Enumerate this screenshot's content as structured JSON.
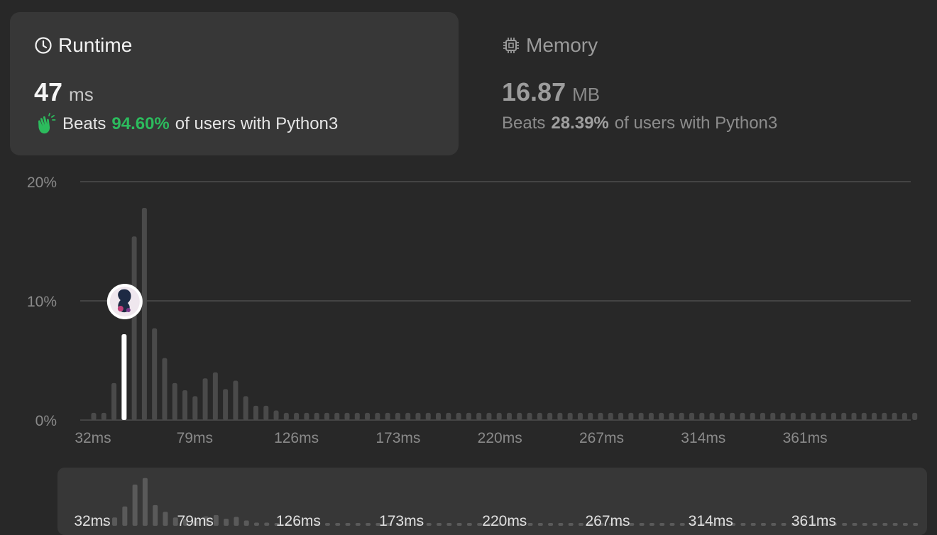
{
  "runtime": {
    "title": "Runtime",
    "value": "47",
    "unit": "ms",
    "beats_label": "Beats",
    "beats_pct": "94.60%",
    "beats_suffix": "of users with Python3",
    "icon": "clock-icon",
    "badge_icon": "clapping-hand-icon"
  },
  "memory": {
    "title": "Memory",
    "value": "16.87",
    "unit": "MB",
    "beats_label": "Beats",
    "beats_pct": "28.39%",
    "beats_suffix": "of users with Python3",
    "icon": "chip-icon"
  },
  "colors": {
    "background": "#282828",
    "card": "#373737",
    "bar": "#4a4a4a",
    "highlight_bar": "#ffffff",
    "accent_green": "#2cbb5d"
  },
  "chart_data": {
    "type": "bar",
    "xlabel": "",
    "ylabel": "",
    "ylim": [
      0,
      20
    ],
    "y_ticks": [
      "20%",
      "10%",
      "0%"
    ],
    "x_ticks": [
      "32ms",
      "79ms",
      "126ms",
      "173ms",
      "220ms",
      "267ms",
      "314ms",
      "361ms"
    ],
    "x_start_ms": 32,
    "x_step_ms": 4.7,
    "highlight_index": 3,
    "values": [
      0.6,
      0.6,
      3.1,
      7.2,
      15.4,
      17.8,
      7.7,
      5.2,
      3.1,
      2.5,
      2.0,
      3.5,
      4.0,
      2.6,
      3.3,
      2.0,
      1.2,
      1.2,
      0.8,
      0.6,
      0.6,
      0.6,
      0.6,
      0.6,
      0.6,
      0.6,
      0.6,
      0.6,
      0.6,
      0.6,
      0.6,
      0.6,
      0.6,
      0.6,
      0.6,
      0.6,
      0.6,
      0.6,
      0.6,
      0.6,
      0.6,
      0.6,
      0.6,
      0.6,
      0.6,
      0.6,
      0.6,
      0.6,
      0.6,
      0.6,
      0.6,
      0.6,
      0.6,
      0.6,
      0.6,
      0.6,
      0.6,
      0.6,
      0.6,
      0.6,
      0.6,
      0.6,
      0.6,
      0.6,
      0.6,
      0.6,
      0.6,
      0.6,
      0.6,
      0.6,
      0.6,
      0.6,
      0.6,
      0.6,
      0.6,
      0.6,
      0.6,
      0.6,
      0.6,
      0.6,
      0.6,
      0.6
    ]
  },
  "overview": {
    "x_ticks": [
      "32ms",
      "79ms",
      "126ms",
      "173ms",
      "220ms",
      "267ms",
      "314ms",
      "361ms"
    ]
  }
}
